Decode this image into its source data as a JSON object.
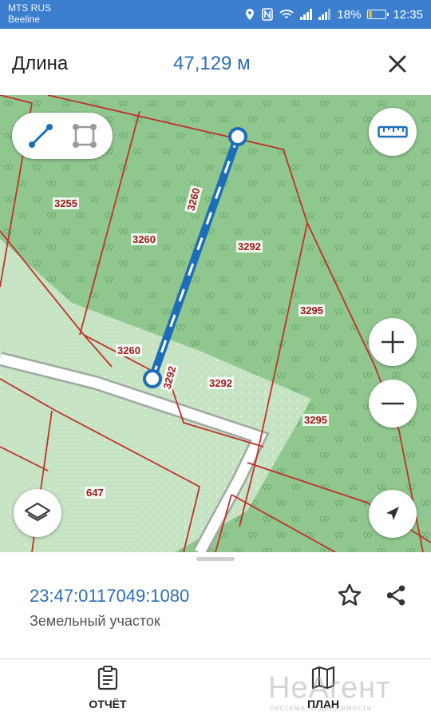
{
  "status_bar": {
    "carrier_1": "MTS RUS",
    "carrier_2": "Beeline",
    "battery": "18%",
    "battery_level": 0.18,
    "time": "12:35"
  },
  "header": {
    "title": "Длина",
    "value": "47,129 м"
  },
  "map": {
    "plot_labels": [
      "3255",
      "3260",
      "3260",
      "3260",
      "3292",
      "3292",
      "3292",
      "3295",
      "3295",
      "647"
    ],
    "icons": [
      "line-measure-icon",
      "polygon-measure-icon",
      "ruler-icon",
      "zoom-in-icon",
      "zoom-out-icon",
      "layers-icon",
      "location-arrow-icon"
    ]
  },
  "sheet": {
    "cadastral_number": "23:47:0117049:1080",
    "object_type": "Земельный участок"
  },
  "nav": {
    "report_label": "ОТЧЁТ",
    "plan_label": "ПЛАН"
  },
  "watermark": {
    "brand": "НеАгент",
    "tagline": "система недвижимости"
  },
  "colors": {
    "status_bar": "#3d7fcf",
    "accent_blue": "#2e6fb2",
    "forest_green": "#8fc78e",
    "boundary_red": "#c0312b"
  }
}
